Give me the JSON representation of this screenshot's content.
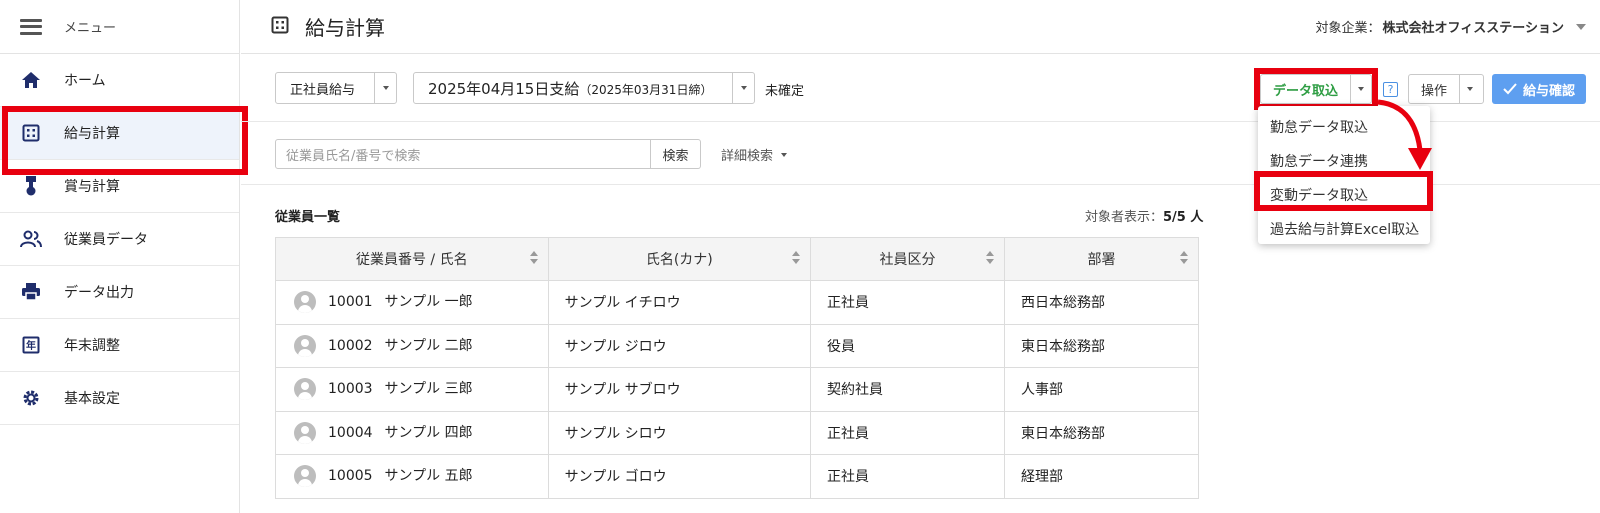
{
  "sidebar": {
    "menu_label": "メニュー",
    "items": [
      {
        "label": "ホーム",
        "icon": "home-icon"
      },
      {
        "label": "給与計算",
        "icon": "calculator-icon",
        "active": true
      },
      {
        "label": "賞与計算",
        "icon": "medal-icon"
      },
      {
        "label": "従業員データ",
        "icon": "people-icon"
      },
      {
        "label": "データ出力",
        "icon": "printer-icon"
      },
      {
        "label": "年末調整",
        "icon": "year-calendar-icon"
      },
      {
        "label": "基本設定",
        "icon": "gear-icon"
      }
    ]
  },
  "header": {
    "title": "給与計算",
    "company_label": "対象企業：",
    "company_name": "株式会社オフィスステーション"
  },
  "toolbar": {
    "payroll_type": "正社員給与",
    "pay_date": "2025年04月15日支給",
    "closing_date": "（2025年03月31日締）",
    "status": "未確定",
    "data_import_label": "データ取込",
    "help_label": "?",
    "operation_label": "操作",
    "confirm_label": "給与確認"
  },
  "dropdown": {
    "items": [
      "勤怠データ取込",
      "勤怠データ連携",
      "変動データ取込",
      "過去給与計算Excel取込"
    ]
  },
  "search": {
    "placeholder": "従業員氏名/番号で検索",
    "button_label": "検索",
    "advanced_label": "詳細検索"
  },
  "employee_list": {
    "title": "従業員一覧",
    "count_label": "対象者表示：",
    "count_value": "5/5 人",
    "columns": [
      "従業員番号 / 氏名",
      "氏名(カナ)",
      "社員区分",
      "部署"
    ],
    "rows": [
      {
        "no": "10001",
        "name": "サンプル 一郎",
        "kana": "サンプル イチロウ",
        "type": "正社員",
        "dept": "西日本総務部"
      },
      {
        "no": "10002",
        "name": "サンプル 二郎",
        "kana": "サンプル ジロウ",
        "type": "役員",
        "dept": "東日本総務部"
      },
      {
        "no": "10003",
        "name": "サンプル 三郎",
        "kana": "サンプル サブロウ",
        "type": "契約社員",
        "dept": "人事部"
      },
      {
        "no": "10004",
        "name": "サンプル 四郎",
        "kana": "サンプル シロウ",
        "type": "正社員",
        "dept": "東日本総務部"
      },
      {
        "no": "10005",
        "name": "サンプル 五郎",
        "kana": "サンプル ゴロウ",
        "type": "正社員",
        "dept": "経理部"
      }
    ]
  },
  "colors": {
    "highlight": "#e8000f",
    "accent_green": "#2e9d43",
    "confirm_blue": "#5e9ff0",
    "sidebar_icon": "#1f2d6b"
  }
}
